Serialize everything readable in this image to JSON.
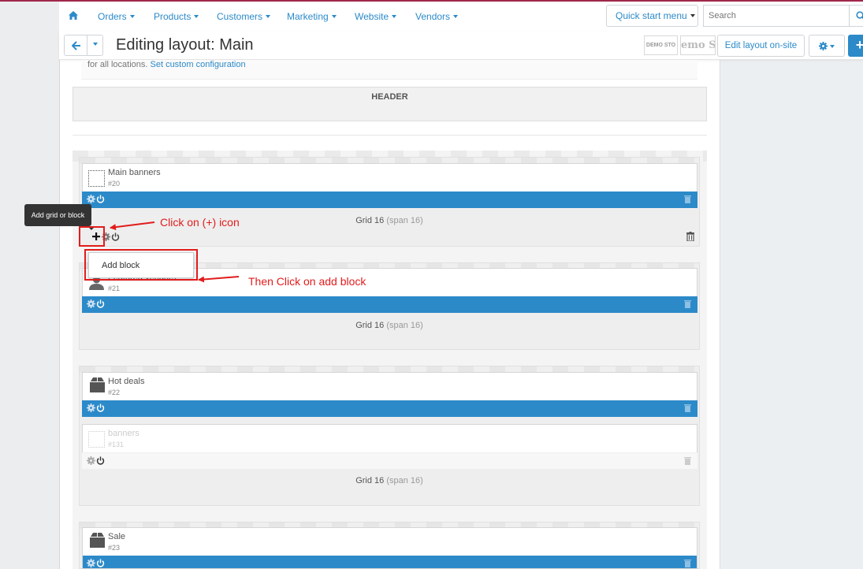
{
  "nav": {
    "menu": [
      {
        "label": "Orders",
        "name": "menu-orders"
      },
      {
        "label": "Products",
        "name": "menu-products"
      },
      {
        "label": "Customers",
        "name": "menu-customers"
      },
      {
        "label": "Marketing",
        "name": "menu-marketing"
      },
      {
        "label": "Website",
        "name": "menu-website"
      },
      {
        "label": "Vendors",
        "name": "menu-vendors"
      }
    ],
    "quick_start": "Quick start menu",
    "search_placeholder": "Search"
  },
  "titlebar": {
    "title": "Editing layout: Main",
    "logo_small": "DEMO STO",
    "logo_big": "emo Sto",
    "edit_button": "Edit layout on-site"
  },
  "info": {
    "text": "for all locations.",
    "link": "Set custom configuration"
  },
  "header_section": {
    "label": "HEADER"
  },
  "grids": [
    {
      "label": "Grid 16",
      "span": "(span 16)"
    },
    {
      "label": "Grid 16",
      "span": "(span 16)"
    },
    {
      "label": "Grid 16",
      "span": "(span 16)"
    }
  ],
  "blocks": [
    {
      "name": "Main banners",
      "id": "#20"
    },
    {
      "name": "Featured vendors",
      "id": "#21"
    },
    {
      "name": "Hot deals",
      "id": "#22"
    },
    {
      "name": "banners",
      "id": "#131"
    },
    {
      "name": "Sale",
      "id": "#23"
    }
  ],
  "tooltip": "Add grid or block",
  "dropdown": {
    "item": "Add block"
  },
  "annotations": {
    "click_plus": "Click on (+) icon",
    "click_add_block": "Then Click on add block"
  },
  "colors": {
    "accent": "#2c8ac9",
    "annotation": "#e21c1c",
    "brand_line": "#a0284a"
  }
}
